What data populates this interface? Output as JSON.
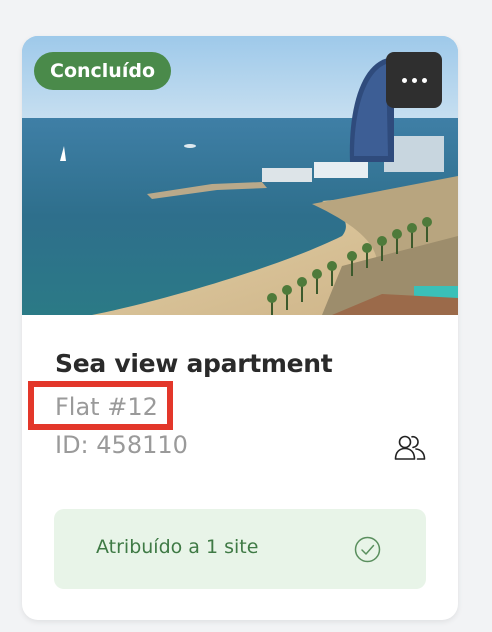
{
  "card": {
    "status_badge": "Concluído",
    "title": "Sea view apartment",
    "subtitle": "Flat #12",
    "id_text": "ID: 458110",
    "more_button_icon": "more-horizontal-icon",
    "people_icon": "people-icon",
    "assigned": {
      "label": "Atribuído a 1 site",
      "icon": "check-circle-icon"
    }
  },
  "colors": {
    "status_badge_bg": "#4a8a4a",
    "highlight_border": "#e3372a",
    "assigned_bg": "#e8f4e8",
    "assigned_text": "#3f7a45"
  }
}
